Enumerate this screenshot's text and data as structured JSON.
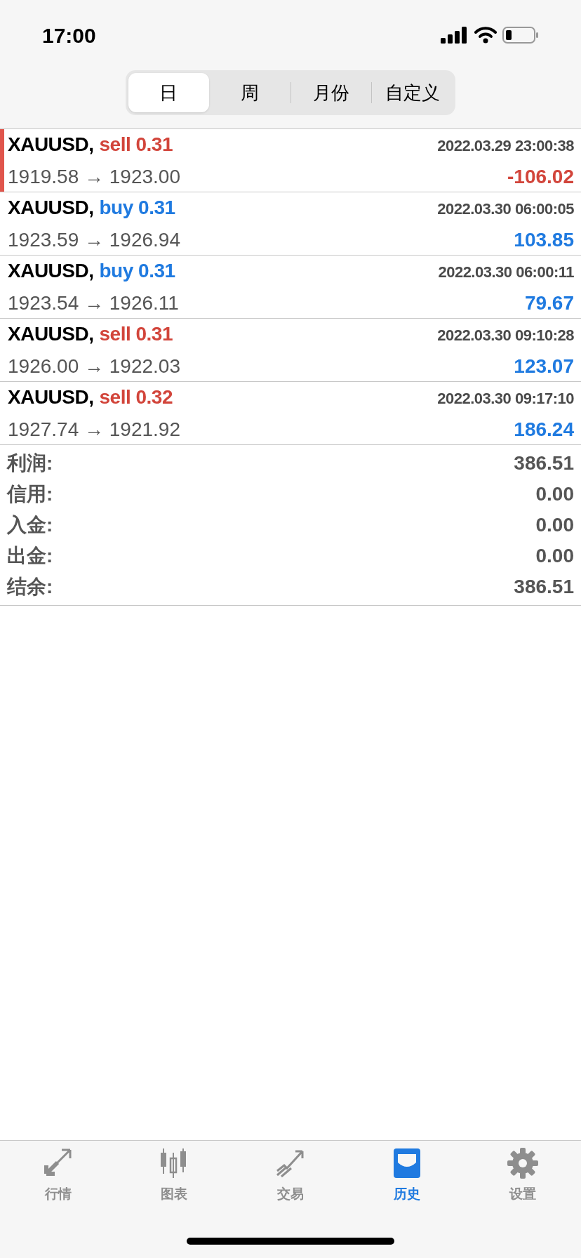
{
  "status_bar": {
    "time": "17:00"
  },
  "period_tabs": [
    {
      "label": "日",
      "selected": true
    },
    {
      "label": "周",
      "selected": false
    },
    {
      "label": "月份",
      "selected": false
    },
    {
      "label": "自定义",
      "selected": false
    }
  ],
  "deals": [
    {
      "symbol": "XAUUSD,",
      "kind": "sell",
      "type_volume": "sell 0.31",
      "time": "2022.03.29 23:00:38",
      "prices": "1919.58 → 1923.00",
      "profit": "-106.02",
      "selected": true
    },
    {
      "symbol": "XAUUSD,",
      "kind": "buy",
      "type_volume": "buy 0.31",
      "time": "2022.03.30 06:00:05",
      "prices": "1923.59 → 1926.94",
      "profit": "103.85",
      "selected": false
    },
    {
      "symbol": "XAUUSD,",
      "kind": "buy",
      "type_volume": "buy 0.31",
      "time": "2022.03.30 06:00:11",
      "prices": "1923.54 → 1926.11",
      "profit": "79.67",
      "selected": false
    },
    {
      "symbol": "XAUUSD,",
      "kind": "sell",
      "type_volume": "sell 0.31",
      "time": "2022.03.30 09:10:28",
      "prices": "1926.00 → 1922.03",
      "profit": "123.07",
      "selected": false
    },
    {
      "symbol": "XAUUSD,",
      "kind": "sell",
      "type_volume": "sell 0.32",
      "time": "2022.03.30 09:17:10",
      "prices": "1927.74 → 1921.92",
      "profit": "186.24",
      "selected": false
    }
  ],
  "summary": [
    {
      "label": "利润:",
      "value": "386.51"
    },
    {
      "label": "信用:",
      "value": "0.00"
    },
    {
      "label": "入金:",
      "value": "0.00"
    },
    {
      "label": "出金:",
      "value": "0.00"
    },
    {
      "label": "结余:",
      "value": "386.51"
    }
  ],
  "tab_bar": [
    {
      "label": "行情",
      "selected": false
    },
    {
      "label": "图表",
      "selected": false
    },
    {
      "label": "交易",
      "selected": false
    },
    {
      "label": "历史",
      "selected": true
    },
    {
      "label": "设置",
      "selected": false
    }
  ]
}
